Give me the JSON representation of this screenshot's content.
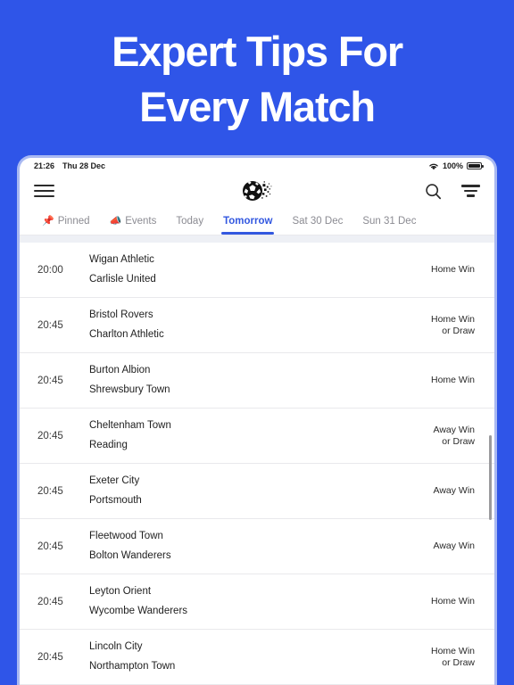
{
  "hero": {
    "line1": "Expert Tips For",
    "line2": "Every Match",
    "bg_color": "#2F55E8",
    "text_color": "#FFFFFF"
  },
  "status_bar": {
    "time": "21:26",
    "date": "Thu 28 Dec",
    "battery_percent": "100%",
    "wifi_icon": "wifi-icon",
    "battery_icon": "battery-full-icon"
  },
  "app_bar": {
    "menu_icon": "hamburger-menu-icon",
    "logo_icon": "soccer-ball-logo",
    "search_icon": "search-icon",
    "filter_icon": "filter-icon"
  },
  "tabs": [
    {
      "label": "Pinned",
      "emoji": "📌",
      "icon": "pin-icon",
      "active": false
    },
    {
      "label": "Events",
      "emoji": "📣",
      "icon": "megaphone-icon",
      "active": false
    },
    {
      "label": "Today",
      "emoji": "",
      "icon": "",
      "active": false
    },
    {
      "label": "Tomorrow",
      "emoji": "",
      "icon": "",
      "active": true
    },
    {
      "label": "Sat 30 Dec",
      "emoji": "",
      "icon": "",
      "active": false
    },
    {
      "label": "Sun 31 Dec",
      "emoji": "",
      "icon": "",
      "active": false
    }
  ],
  "accent_color": "#3358E0",
  "matches": [
    {
      "time": "20:00",
      "home": "Wigan Athletic",
      "away": "Carlisle United",
      "tip": "Home Win"
    },
    {
      "time": "20:45",
      "home": "Bristol Rovers",
      "away": "Charlton Athletic",
      "tip": "Home Win\nor Draw"
    },
    {
      "time": "20:45",
      "home": "Burton Albion",
      "away": "Shrewsbury Town",
      "tip": "Home Win"
    },
    {
      "time": "20:45",
      "home": "Cheltenham Town",
      "away": "Reading",
      "tip": "Away Win\nor Draw"
    },
    {
      "time": "20:45",
      "home": "Exeter City",
      "away": "Portsmouth",
      "tip": "Away Win"
    },
    {
      "time": "20:45",
      "home": "Fleetwood Town",
      "away": "Bolton Wanderers",
      "tip": "Away Win"
    },
    {
      "time": "20:45",
      "home": "Leyton Orient",
      "away": "Wycombe Wanderers",
      "tip": "Home Win"
    },
    {
      "time": "20:45",
      "home": "Lincoln City",
      "away": "Northampton Town",
      "tip": "Home Win\nor Draw"
    }
  ]
}
